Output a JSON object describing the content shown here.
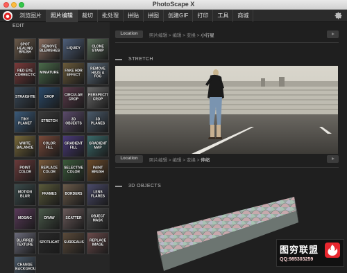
{
  "window": {
    "title": "PhotoScape X"
  },
  "menu": {
    "tabs": [
      {
        "label": "浏览图片"
      },
      {
        "label": "照片编辑"
      },
      {
        "label": "裁切"
      },
      {
        "label": "批处理"
      },
      {
        "label": "拼贴"
      },
      {
        "label": "拼图"
      },
      {
        "label": "创建GIF"
      },
      {
        "label": "打印"
      },
      {
        "label": "工具"
      },
      {
        "label": "商城"
      }
    ],
    "active_index": 1,
    "settings_icon": "gear-icon"
  },
  "sidebar": {
    "title": "EDIT",
    "tools": [
      {
        "label": "SPOT HEALING BRUSH",
        "color": "#6b5a4a"
      },
      {
        "label": "REMOVE BLEMISHES",
        "color": "#8a6e60"
      },
      {
        "label": "LIQUIFY",
        "color": "#4e5f7a"
      },
      {
        "label": "CLONE STAMP",
        "color": "#5a6e5a"
      },
      {
        "label": "RED EYE CORRECTION",
        "color": "#7a3a3a"
      },
      {
        "label": "MINIATURE",
        "color": "#4a6a4a"
      },
      {
        "label": "FAKE HDR EFFECT",
        "color": "#6a5a3a"
      },
      {
        "label": "REMOVE HAZE & FOG",
        "color": "#5a6a7a"
      },
      {
        "label": "STRAIGHTEN",
        "color": "#3a4a5a"
      },
      {
        "label": "CROP",
        "color": "#2a4a6a"
      },
      {
        "label": "CIRCULAR CROP",
        "color": "#5a3a4a"
      },
      {
        "label": "PERSPECTIVE CROP",
        "color": "#6a6a6a"
      },
      {
        "label": "TINY PLANET",
        "color": "#3a5a7a"
      },
      {
        "label": "STRETCH",
        "color": "#3a3a3a"
      },
      {
        "label": "3D OBJECTS",
        "color": "#5a4a6a"
      },
      {
        "label": "3D PLANES",
        "color": "#4a5a6a"
      },
      {
        "label": "WHITE BALANCE",
        "color": "#7a6a3a"
      },
      {
        "label": "COLOR FILL",
        "color": "#7a4a3a"
      },
      {
        "label": "GRADIENT FILL",
        "color": "#4a3a7a"
      },
      {
        "label": "GRADIENT MAP",
        "color": "#3a6a6a"
      },
      {
        "label": "POINT COLOR",
        "color": "#6a3a3a"
      },
      {
        "label": "REPLACE COLOR",
        "color": "#7a5a3a"
      },
      {
        "label": "SELECTIVE COLOR",
        "color": "#3a5a3a"
      },
      {
        "label": "PAINT BRUSH",
        "color": "#6a4a2a"
      },
      {
        "label": "MOTION BLUR",
        "color": "#3a4a4a"
      },
      {
        "label": "FRAMES",
        "color": "#5a5a3a"
      },
      {
        "label": "BORDERS",
        "color": "#6a5a4a"
      },
      {
        "label": "LENS FLARES",
        "color": "#4a4a6a"
      },
      {
        "label": "MOSAIC",
        "color": "#5a3a5a"
      },
      {
        "label": "DRAW",
        "color": "#4a5a4a"
      },
      {
        "label": "SCATTER",
        "color": "#6a5a5a"
      },
      {
        "label": "OBJECT MASK",
        "color": "#4a4a4a"
      },
      {
        "label": "BLURRED TEXTURE",
        "color": "#6a6a7a"
      },
      {
        "label": "SPOTLIGHT",
        "color": "#2a2a2a"
      },
      {
        "label": "SURREALISTIC",
        "color": "#5a4a3a"
      },
      {
        "label": "REPLACE IMAGE",
        "color": "#6a4a4a"
      },
      {
        "label": "CHANGE BACKGROUND",
        "color": "#4a5a6a"
      }
    ]
  },
  "main": {
    "sections": [
      {
        "location_button": "Location",
        "breadcrumb_prefix": "照片编辑 > 编辑 > 变换 > ",
        "breadcrumb_current": "小行星",
        "heading": "STRETCH",
        "video_icon": "play-icon"
      },
      {
        "location_button": "Location",
        "breadcrumb_prefix": "照片编辑 > 编辑 > 变换 > ",
        "breadcrumb_current": "伸缩",
        "heading": "3D OBJECTS",
        "video_icon": "play-icon"
      }
    ]
  },
  "watermark": {
    "title": "图穷联盟",
    "contact": "QQ:985303259",
    "logo_icon": "flame-badge-icon"
  }
}
